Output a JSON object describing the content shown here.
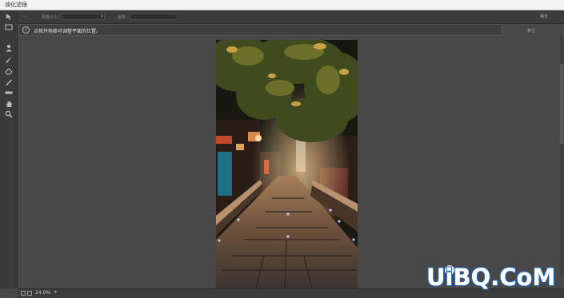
{
  "window": {
    "title": "液化滤镜"
  },
  "options": {
    "field1_label": "—",
    "field2_label": "网格大小:",
    "field3_label": "画笔:",
    "confirm_label": "确定"
  },
  "hint": {
    "message": "点按并拖移可调整平面的位置。",
    "reset_label": "复位"
  },
  "tools": [
    "move-tool-icon",
    "rect-select-icon",
    "person-icon",
    "brush-icon",
    "eraser-icon",
    "eyedropper-icon",
    "ruler-icon",
    "hand-icon",
    "zoom-icon"
  ],
  "status": {
    "zoom": "24.9%"
  },
  "watermark": {
    "text": "UiBQ.CoM"
  }
}
